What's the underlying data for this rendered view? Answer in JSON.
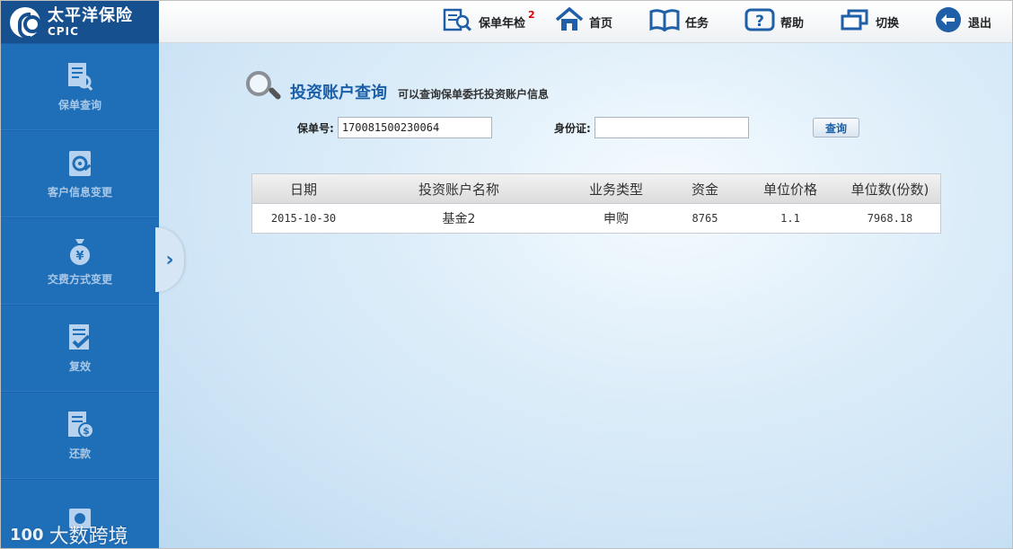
{
  "brand": {
    "name_cn": "太平洋保险",
    "name_en": "CPIC"
  },
  "topnav": [
    {
      "label": "保单年检",
      "badge": "2",
      "icon": "policy-search-icon"
    },
    {
      "label": "首页",
      "icon": "home-icon"
    },
    {
      "label": "任务",
      "icon": "book-icon"
    },
    {
      "label": "帮助",
      "icon": "help-icon"
    },
    {
      "label": "切换",
      "icon": "switch-window-icon"
    },
    {
      "label": "退出",
      "icon": "exit-icon"
    }
  ],
  "sidebar": {
    "items": [
      {
        "label": "保单查询",
        "icon": "document-search-icon"
      },
      {
        "label": "客户信息变更",
        "icon": "customer-info-icon"
      },
      {
        "label": "交费方式变更",
        "icon": "money-bag-icon"
      },
      {
        "label": "复效",
        "icon": "document-check-icon"
      },
      {
        "label": "还款",
        "icon": "document-dollar-icon"
      },
      {
        "label": "",
        "icon": "money-icon"
      }
    ],
    "collapse_glyph": "›"
  },
  "page": {
    "title": "投资账户查询",
    "description": "可以查询保单委托投资账户信息",
    "policy_label": "保单号:",
    "policy_value": "17008150023006​4",
    "id_label": "身份证:",
    "id_value": "",
    "query_button": "查询"
  },
  "table": {
    "headers": [
      "日期",
      "投资账户名称",
      "业务类型",
      "资金",
      "单位价格",
      "单位数(份数)"
    ],
    "rows": [
      [
        "2015-10-30",
        "基金2",
        "申购",
        "8765",
        "1.1",
        "7968.18"
      ]
    ]
  },
  "watermark": {
    "mark": "100",
    "text": "大数跨境"
  },
  "colors": {
    "sidebar": "#1f6fb8",
    "logo_bg": "#17508e",
    "title": "#1a5fa8",
    "badge": "#dd0000"
  }
}
